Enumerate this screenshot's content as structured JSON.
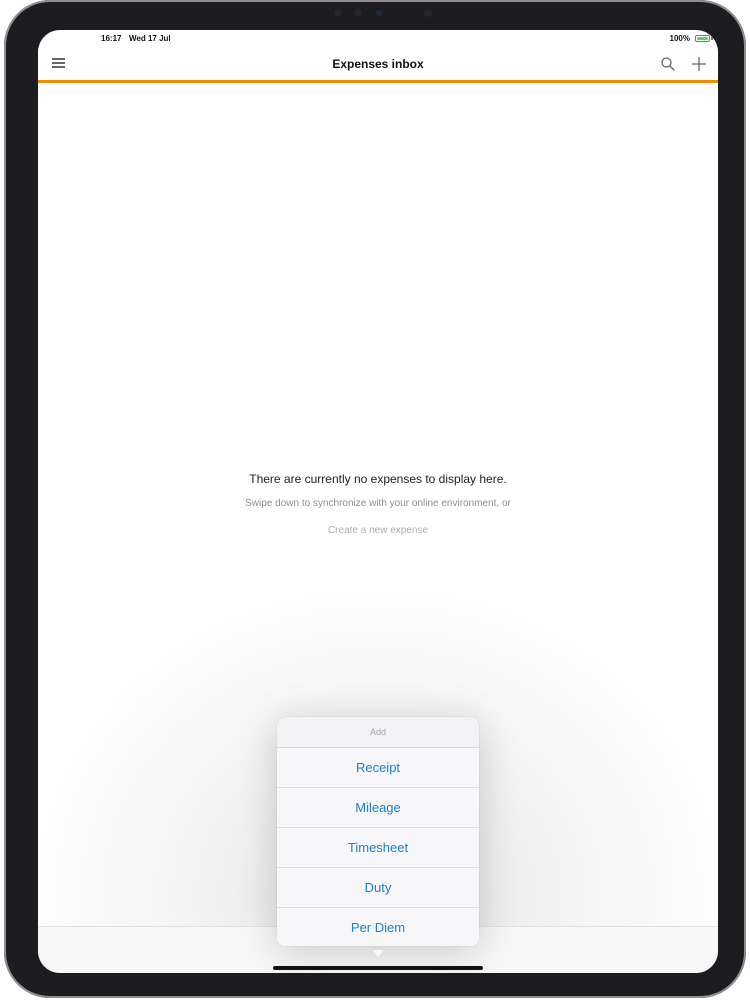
{
  "status_bar": {
    "time": "16:17",
    "date": "Wed 17 Jul",
    "battery": "100%"
  },
  "nav": {
    "title": "Expenses inbox",
    "menu_icon": "hamburger-menu-icon",
    "search_icon": "search-icon",
    "add_icon": "plus-icon"
  },
  "empty_state": {
    "title": "There are currently no expenses to display here.",
    "subtitle": "Swipe down to synchronize with your online environment, or",
    "link": "Create a new expense"
  },
  "add_menu": {
    "header": "Add",
    "items": [
      {
        "label": "Receipt"
      },
      {
        "label": "Mileage"
      },
      {
        "label": "Timesheet"
      },
      {
        "label": "Duty"
      },
      {
        "label": "Per Diem"
      }
    ]
  },
  "colors": {
    "accent": "#f08c00",
    "action_blue": "#1a7fd4"
  }
}
